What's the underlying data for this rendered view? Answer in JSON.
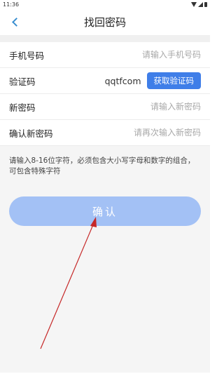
{
  "status": {
    "time": "11:36"
  },
  "header": {
    "title": "找回密码"
  },
  "form": {
    "phone": {
      "label": "手机号码",
      "placeholder": "请输入手机号码"
    },
    "code": {
      "label": "验证码",
      "value": "qqtfcom",
      "button": "获取验证码"
    },
    "new_password": {
      "label": "新密码",
      "placeholder": "请输入新密码"
    },
    "confirm_password": {
      "label": "确认新密码",
      "placeholder": "请再次输入新密码"
    }
  },
  "hint": "请输入8-16位字符，必须包含大小写字母和数字的组合，可包含特殊字符",
  "confirm_label": "确认",
  "colors": {
    "accent": "#3f7ee8",
    "confirm_disabled": "#a3c1f5",
    "annotation_arrow": "#c62828"
  }
}
